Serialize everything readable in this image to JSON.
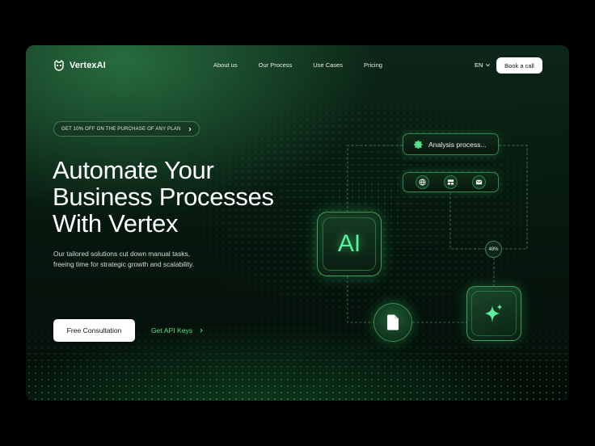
{
  "brand": {
    "name": "VertexAI"
  },
  "nav": {
    "links": [
      "About us",
      "Our Process",
      "Use Cases",
      "Pricing"
    ],
    "language": "EN",
    "book_label": "Book a call"
  },
  "hero": {
    "promo": "GET 10% OFF ON THE PURCHASE OF ANY PLAN",
    "title_lines": [
      "Automate Your",
      "Business Processes",
      "With Vertex"
    ],
    "description": "Our tailored solutions cut down manual tasks, freeing time for strategic growth and scalability.",
    "primary_cta": "Free Consultation",
    "secondary_cta": "Get API Keys"
  },
  "diagram": {
    "status_label": "Analysis process...",
    "ai_label": "AI",
    "progress": "48%",
    "icons": [
      "gear-icon",
      "globe-icon",
      "layout-icon",
      "mail-icon",
      "file-icon",
      "sparkle-icon"
    ]
  },
  "colors": {
    "accent": "#4fe38a",
    "background": "#071a10"
  }
}
